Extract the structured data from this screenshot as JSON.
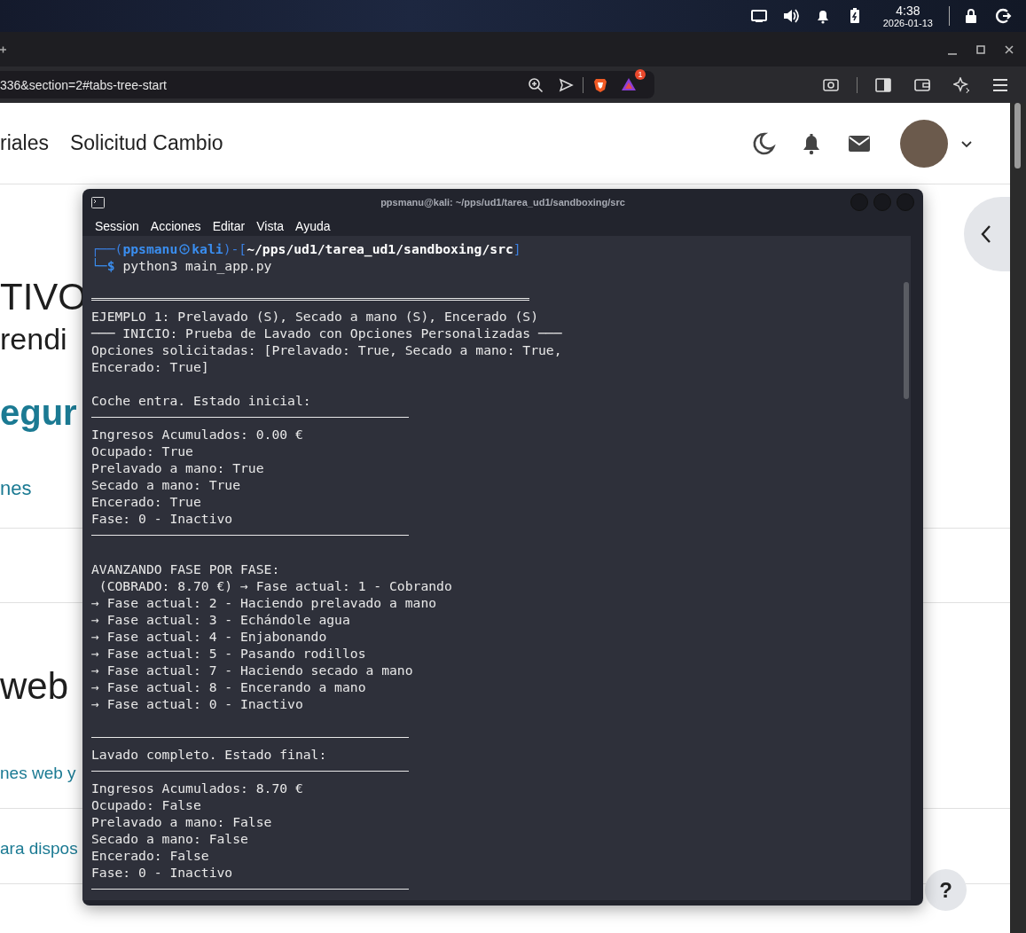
{
  "desktop_panel": {
    "time": "4:38",
    "date": "2026-01-13"
  },
  "browser": {
    "url": "336&section=2#tabs-tree-start",
    "rewards_badge": "1"
  },
  "page": {
    "nav_links": [
      "riales",
      "Solicitud Cambio"
    ],
    "content": [
      {
        "kind": "heading",
        "text": "TIVO"
      },
      {
        "kind": "subheading",
        "text": "rendi"
      },
      {
        "kind": "title",
        "text": "egur"
      },
      {
        "kind": "tabs",
        "items": [
          "nes"
        ]
      },
      {
        "kind": "heading",
        "text": "web"
      },
      {
        "kind": "link",
        "text": "nes web y"
      },
      {
        "kind": "link",
        "text": "ara dispos"
      }
    ],
    "help": "?"
  },
  "terminal": {
    "title": "ppsmanu@kali: ~/pps/ud1/tarea_ud1/sandboxing/src",
    "menu": [
      "Session",
      "Acciones",
      "Editar",
      "Vista",
      "Ayuda"
    ],
    "lines": [
      {
        "kind": "prompt",
        "open": "┌──(",
        "user": "ppsmanu",
        "host": "kali",
        "mid": ")-[",
        "path": "~/pps/ud1/tarea_ud1/sandboxing/src",
        "close": "]"
      },
      {
        "kind": "command",
        "prompt": "└─$",
        "text": "python3 main_app.py"
      },
      {
        "kind": "blank"
      },
      {
        "kind": "double_rule"
      },
      {
        "kind": "text",
        "text": "EJEMPLO 1: Prelavado (S), Secado a mano (S), Encerado (S)"
      },
      {
        "kind": "text",
        "text": "─── INICIO: Prueba de Lavado con Opciones Personalizadas ───"
      },
      {
        "kind": "text",
        "text": "Opciones solicitadas: [Prelavado: True, Secado a mano: True,"
      },
      {
        "kind": "text",
        "text": "Encerado: True]"
      },
      {
        "kind": "blank"
      },
      {
        "kind": "text",
        "text": "Coche entra. Estado inicial:"
      },
      {
        "kind": "rule"
      },
      {
        "kind": "text",
        "text": "Ingresos Acumulados: 0.00 €"
      },
      {
        "kind": "text",
        "text": "Ocupado: True"
      },
      {
        "kind": "text",
        "text": "Prelavado a mano: True"
      },
      {
        "kind": "text",
        "text": "Secado a mano: True"
      },
      {
        "kind": "text",
        "text": "Encerado: True"
      },
      {
        "kind": "text",
        "text": "Fase: 0 - Inactivo"
      },
      {
        "kind": "rule"
      },
      {
        "kind": "blank"
      },
      {
        "kind": "text",
        "text": "AVANZANDO FASE POR FASE:"
      },
      {
        "kind": "text",
        "text": " (COBRADO: 8.70 €) → Fase actual: 1 - Cobrando"
      },
      {
        "kind": "text",
        "text": "→ Fase actual: 2 - Haciendo prelavado a mano"
      },
      {
        "kind": "text",
        "text": "→ Fase actual: 3 - Echándole agua"
      },
      {
        "kind": "text",
        "text": "→ Fase actual: 4 - Enjabonando"
      },
      {
        "kind": "text",
        "text": "→ Fase actual: 5 - Pasando rodillos"
      },
      {
        "kind": "text",
        "text": "→ Fase actual: 7 - Haciendo secado a mano"
      },
      {
        "kind": "text",
        "text": "→ Fase actual: 8 - Encerando a mano"
      },
      {
        "kind": "text",
        "text": "→ Fase actual: 0 - Inactivo"
      },
      {
        "kind": "blank"
      },
      {
        "kind": "rule"
      },
      {
        "kind": "text",
        "text": "Lavado completo. Estado final:"
      },
      {
        "kind": "rule"
      },
      {
        "kind": "text",
        "text": "Ingresos Acumulados: 8.70 €"
      },
      {
        "kind": "text",
        "text": "Ocupado: False"
      },
      {
        "kind": "text",
        "text": "Prelavado a mano: False"
      },
      {
        "kind": "text",
        "text": "Secado a mano: False"
      },
      {
        "kind": "text",
        "text": "Encerado: False"
      },
      {
        "kind": "text",
        "text": "Fase: 0 - Inactivo"
      },
      {
        "kind": "rule"
      }
    ]
  }
}
